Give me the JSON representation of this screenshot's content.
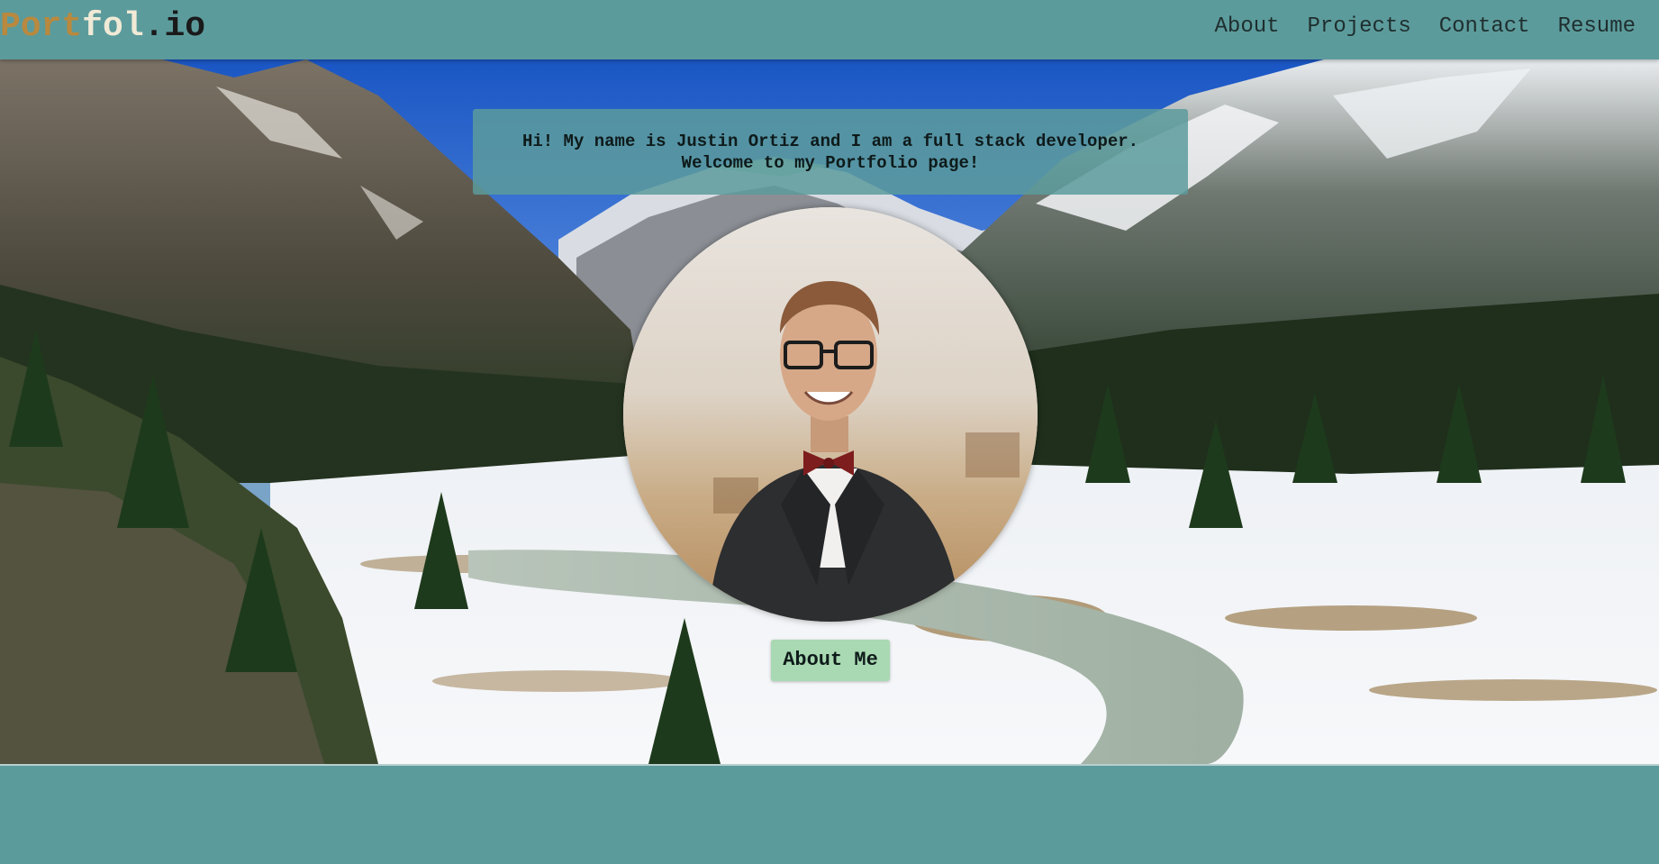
{
  "brand": {
    "part1": "Port",
    "part2": "fol",
    "part3": ".io"
  },
  "nav": {
    "items": [
      {
        "label": "About"
      },
      {
        "label": "Projects"
      },
      {
        "label": "Contact"
      },
      {
        "label": "Resume"
      }
    ]
  },
  "hero": {
    "greeting_line1": "Hi! My name is Justin Ortiz and I am a full stack developer.",
    "greeting_line2": "Welcome to my Portfolio page!",
    "button_label": "About Me",
    "background_image": "snowy-mountain-valley-photo",
    "portrait_image": "profile-portrait-photo"
  },
  "colors": {
    "header_bg": "#5c9b9c",
    "brand_part1": "#b8893e",
    "brand_part2": "#f0ead6",
    "brand_part3": "#1a1a1a",
    "button_bg": "#a9d9b2"
  }
}
